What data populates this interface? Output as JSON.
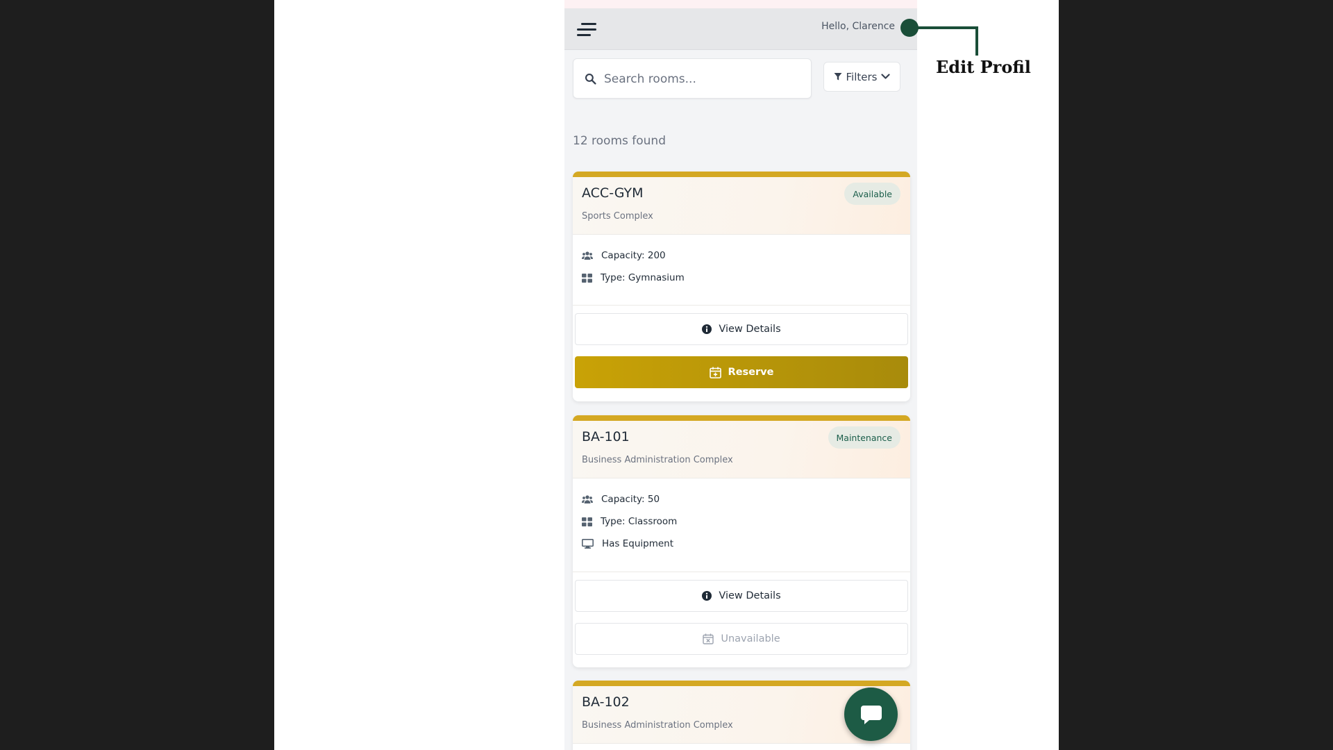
{
  "header": {
    "greeting": "Hello, Clarence"
  },
  "search": {
    "placeholder": "Search rooms...",
    "filters_label": "Filters"
  },
  "results": {
    "count_text": "12 rooms found"
  },
  "rooms": [
    {
      "name": "ACC-GYM",
      "building": "Sports Complex",
      "status": "Available",
      "features": [
        "Capacity: 200",
        "Type: Gymnasium"
      ],
      "view_label": "View Details",
      "action_label": "Reserve"
    },
    {
      "name": "BA-101",
      "building": "Business Administration Complex",
      "status": "Maintenance",
      "features": [
        "Capacity: 50",
        "Type: Classroom",
        "Has Equipment"
      ],
      "view_label": "View Details",
      "action_label": "Unavailable"
    },
    {
      "name": "BA-102",
      "building": "Business Administration Complex"
    }
  ],
  "annotation": {
    "label": "Edit Profil"
  },
  "colors": {
    "accent_gold": "#d4a823",
    "reserve_gradient_start": "#c9a206",
    "reserve_gradient_end": "#a88b0b",
    "brand_green": "#1d5b45"
  },
  "icons": {
    "menu": "menu-icon",
    "search": "search-icon",
    "filter": "filter-icon",
    "chevron": "chevron-down-icon",
    "users": "users-icon",
    "type": "grid-icon",
    "equipment": "monitor-icon",
    "info": "info-circle-icon",
    "calendar_plus": "calendar-plus-icon",
    "calendar_x": "calendar-x-icon",
    "chat": "chat-icon"
  }
}
